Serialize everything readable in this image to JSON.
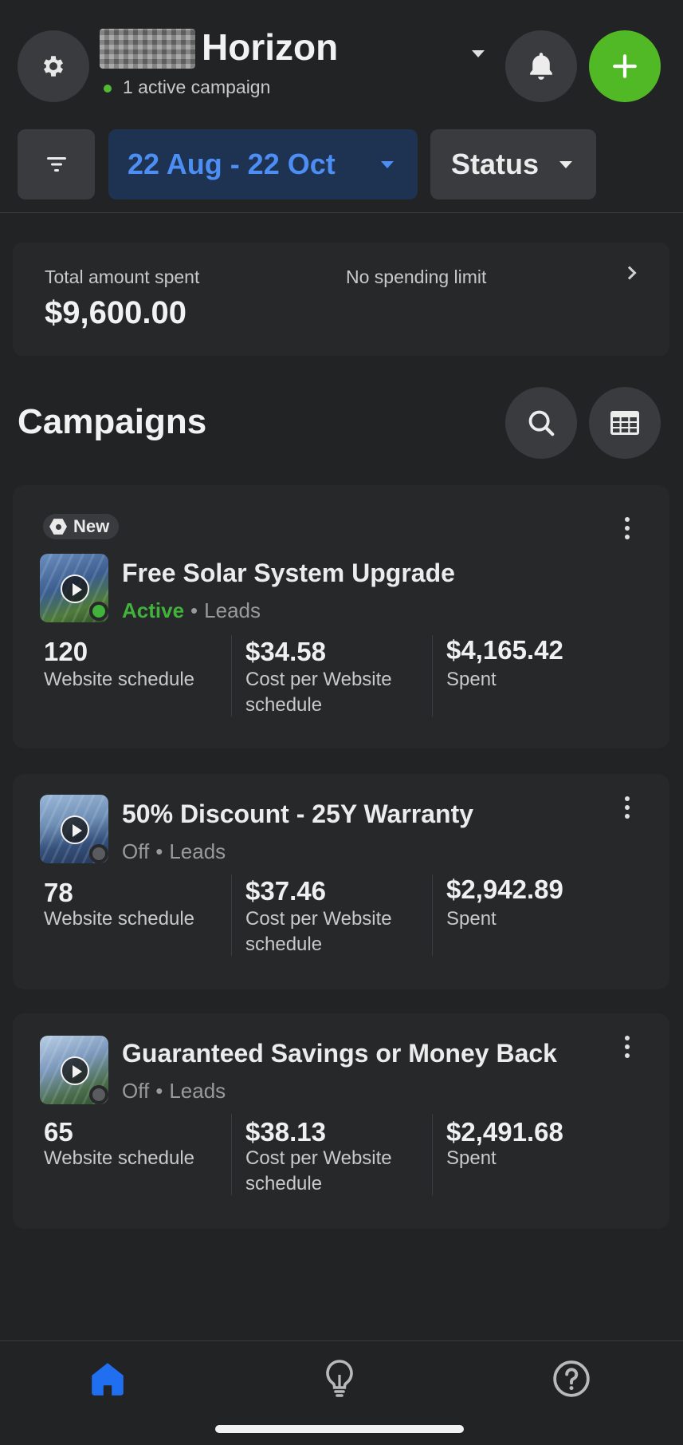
{
  "header": {
    "title": "Horizon",
    "subtitle": "1 active campaign",
    "settings_icon": "gear-icon",
    "notifications_icon": "bell-icon",
    "add_icon": "plus-icon",
    "accent_add": "#51b926"
  },
  "filters": {
    "date_range": "22 Aug - 22 Oct",
    "status_label": "Status"
  },
  "spend": {
    "total_label": "Total amount spent",
    "currency": "$",
    "total_value": "9,600.00",
    "limit_label": "No spending limit"
  },
  "campaigns": {
    "title": "Campaigns",
    "items": [
      {
        "badge": "New",
        "name": "Free Solar System Upgrade",
        "status": "Active",
        "objective": "Leads",
        "results": "120",
        "results_label": "Website schedule",
        "cost_currency": "$",
        "cost": "34.58",
        "cost_label_1": "Cost per Website",
        "cost_label_2": "schedule",
        "spent_currency": "$",
        "spent": "4,165.42",
        "spent_label": "Spent",
        "status_color": "#41b23b"
      },
      {
        "name": "50% Discount - 25Y Warranty",
        "status": "Off",
        "objective": "Leads",
        "results": "78",
        "results_label": "Website schedule",
        "cost_currency": "$",
        "cost": "37.46",
        "cost_label_1": "Cost per Website",
        "cost_label_2": "schedule",
        "spent_currency": "$",
        "spent": "2,942.89",
        "spent_label": "Spent",
        "status_color": "#5a5b5e"
      },
      {
        "name": "Guaranteed Savings or Money Back",
        "status": "Off",
        "objective": "Leads",
        "results": "65",
        "results_label": "Website schedule",
        "cost_currency": "$",
        "cost": "38.13",
        "cost_label_1": "Cost per Website",
        "cost_label_2": "schedule",
        "spent_currency": "$",
        "spent": "2,491.68",
        "spent_label": "Spent",
        "status_color": "#5a5b5e"
      }
    ]
  },
  "bottom_nav": {
    "items": [
      "home-icon",
      "lightbulb-icon",
      "help-icon"
    ],
    "active_color": "#1f6ff0"
  }
}
